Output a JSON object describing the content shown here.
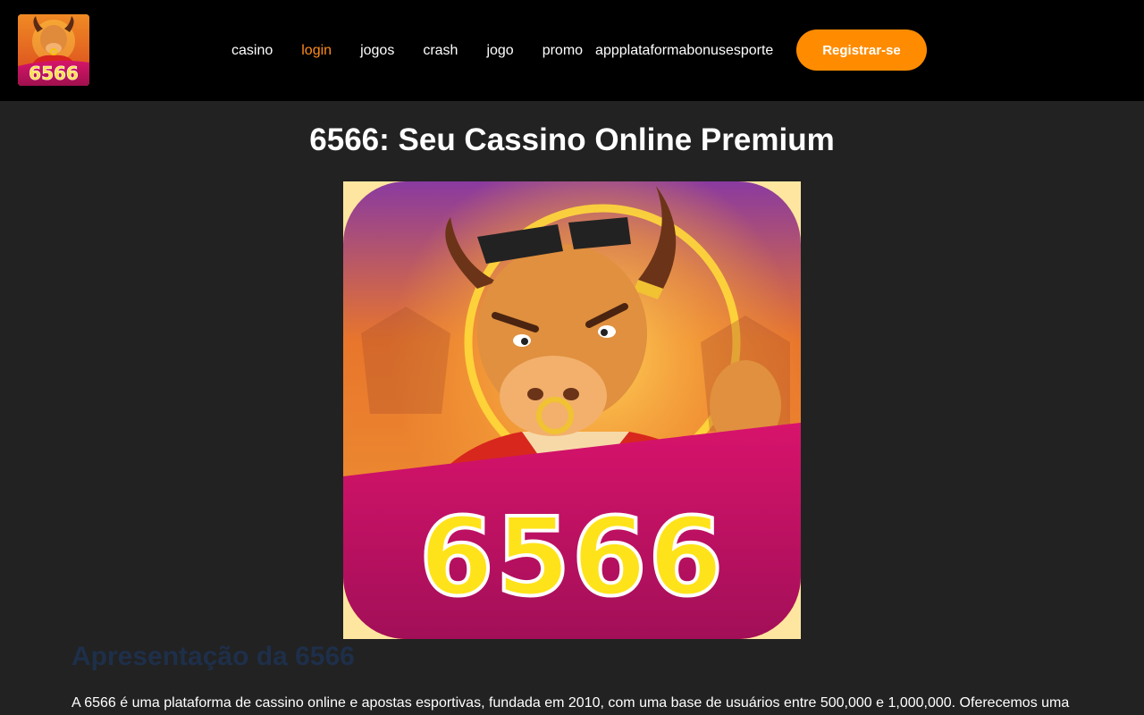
{
  "header": {
    "logo_text": "6566",
    "nav": [
      {
        "label": "casino",
        "active": false
      },
      {
        "label": "login",
        "active": true
      },
      {
        "label": "jogos",
        "active": false
      },
      {
        "label": "crash",
        "active": false
      },
      {
        "label": "jogo",
        "active": false
      },
      {
        "label": "promo",
        "active": false
      },
      {
        "label": "app",
        "active": false
      },
      {
        "label": "plataforma",
        "active": false
      },
      {
        "label": "bonus",
        "active": false
      },
      {
        "label": "esporte",
        "active": false
      }
    ],
    "register_label": "Registrar-se"
  },
  "main": {
    "title": "6566: Seu Cassino Online Premium",
    "hero_text": "6566",
    "section_heading": "Apresentação da 6566",
    "intro": "A 6566 é uma plataforma de cassino online e apostas esportivas, fundada em 2010, com uma base de usuários entre 500,000 e 1,000,000. Oferecemos uma"
  },
  "colors": {
    "accent": "#ff8c00",
    "active_link": "#ff8c1a",
    "page_bg": "#222222",
    "header_bg": "#000000",
    "heading_dark": "#1e2f4a"
  }
}
